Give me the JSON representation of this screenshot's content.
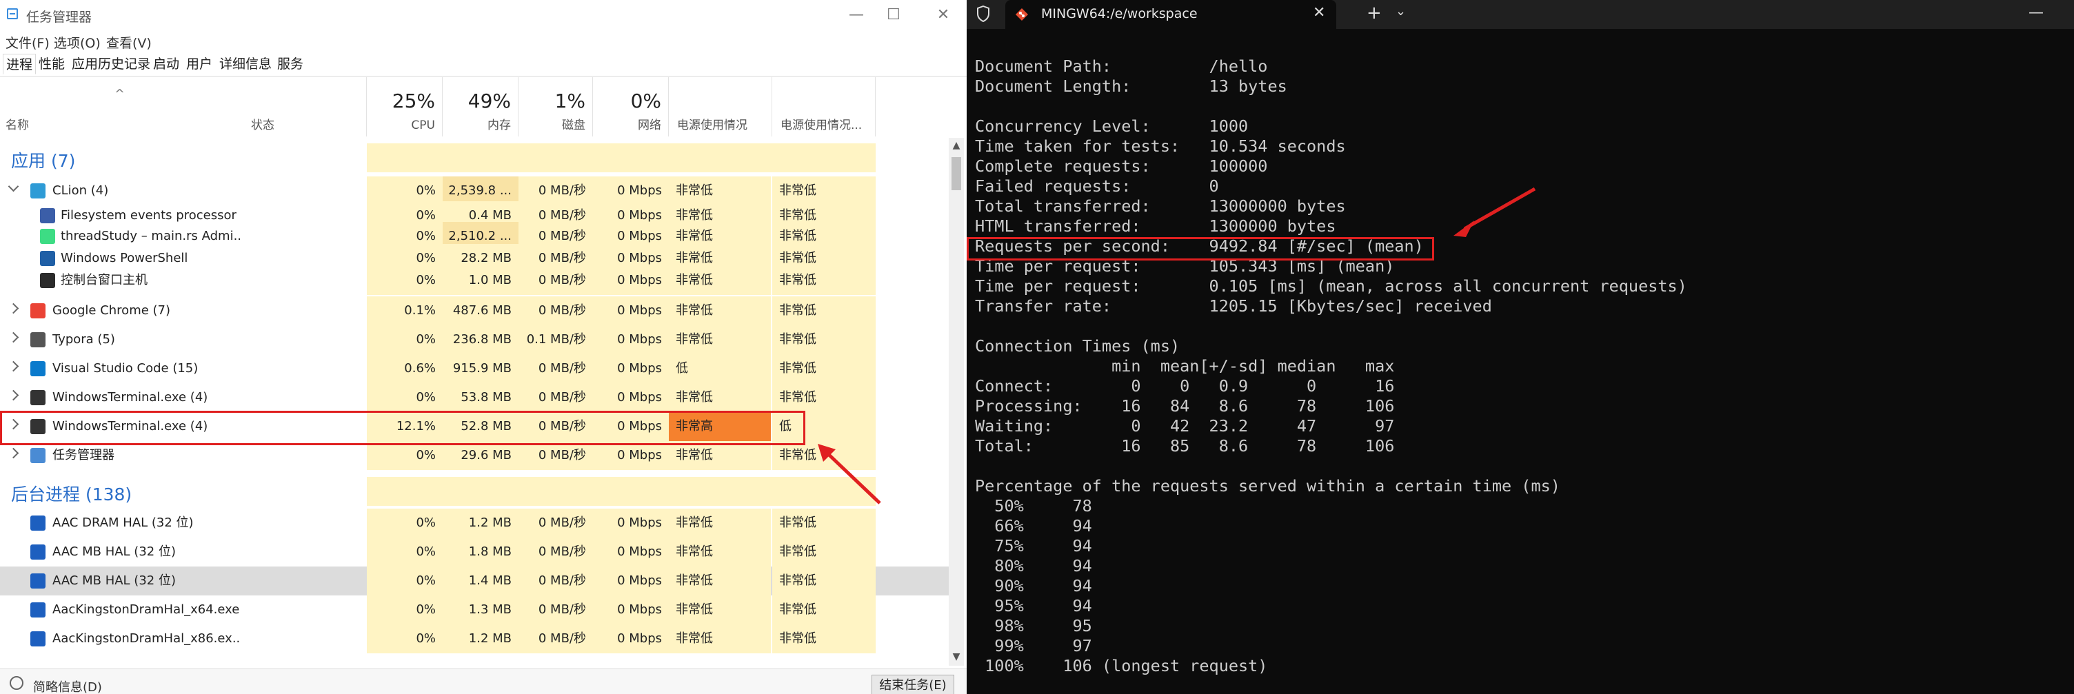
{
  "task_manager": {
    "title": "任务管理器",
    "window_controls": {
      "minimize": "—",
      "maximize": "☐",
      "close": "✕"
    },
    "menu": [
      "文件(F)",
      "选项(O)",
      "查看(V)"
    ],
    "tabs": [
      "进程",
      "性能",
      "应用历史记录",
      "启动",
      "用户",
      "详细信息",
      "服务"
    ],
    "columns": {
      "name": "名称",
      "status": "状态",
      "cpu": {
        "pct": "25%",
        "label": "CPU"
      },
      "memory": {
        "pct": "49%",
        "label": "内存"
      },
      "disk": {
        "pct": "1%",
        "label": "磁盘"
      },
      "network": {
        "pct": "0%",
        "label": "网络"
      },
      "power": "电源使用情况",
      "power_trend": "电源使用情况..."
    },
    "groups": {
      "apps": "应用 (7)",
      "background": "后台进程 (138)"
    },
    "rows": [
      {
        "name": "CLion (4)",
        "cpu": "0%",
        "mem": "2,539.8 ...",
        "disk": "0 MB/秒",
        "net": "0 Mbps",
        "power": "非常低",
        "trend": "非常低"
      },
      {
        "name": "Filesystem events processor",
        "cpu": "0%",
        "mem": "0.4 MB",
        "disk": "0 MB/秒",
        "net": "0 Mbps",
        "power": "非常低",
        "trend": "非常低"
      },
      {
        "name": "threadStudy – main.rs Admi...",
        "cpu": "0%",
        "mem": "2,510.2 ...",
        "disk": "0 MB/秒",
        "net": "0 Mbps",
        "power": "非常低",
        "trend": "非常低"
      },
      {
        "name": "Windows PowerShell",
        "cpu": "0%",
        "mem": "28.2 MB",
        "disk": "0 MB/秒",
        "net": "0 Mbps",
        "power": "非常低",
        "trend": "非常低"
      },
      {
        "name": "控制台窗口主机",
        "cpu": "0%",
        "mem": "1.0 MB",
        "disk": "0 MB/秒",
        "net": "0 Mbps",
        "power": "非常低",
        "trend": "非常低"
      },
      {
        "name": "Google Chrome (7)",
        "cpu": "0.1%",
        "mem": "487.6 MB",
        "disk": "0 MB/秒",
        "net": "0 Mbps",
        "power": "非常低",
        "trend": "非常低"
      },
      {
        "name": "Typora (5)",
        "cpu": "0%",
        "mem": "236.8 MB",
        "disk": "0.1 MB/秒",
        "net": "0 Mbps",
        "power": "非常低",
        "trend": "非常低"
      },
      {
        "name": "Visual Studio Code (15)",
        "cpu": "0.6%",
        "mem": "915.9 MB",
        "disk": "0 MB/秒",
        "net": "0 Mbps",
        "power": "低",
        "trend": "非常低"
      },
      {
        "name": "WindowsTerminal.exe (4)",
        "cpu": "0%",
        "mem": "53.8 MB",
        "disk": "0 MB/秒",
        "net": "0 Mbps",
        "power": "非常低",
        "trend": "非常低"
      },
      {
        "name": "WindowsTerminal.exe (4)",
        "cpu": "12.1%",
        "mem": "52.8 MB",
        "disk": "0 MB/秒",
        "net": "0 Mbps",
        "power": "非常高",
        "trend": "低"
      },
      {
        "name": "任务管理器",
        "cpu": "0%",
        "mem": "29.6 MB",
        "disk": "0 MB/秒",
        "net": "0 Mbps",
        "power": "非常低",
        "trend": "非常低"
      },
      {
        "name": "AAC DRAM HAL (32 位)",
        "cpu": "0%",
        "mem": "1.2 MB",
        "disk": "0 MB/秒",
        "net": "0 Mbps",
        "power": "非常低",
        "trend": "非常低"
      },
      {
        "name": "AAC MB HAL (32 位)",
        "cpu": "0%",
        "mem": "1.8 MB",
        "disk": "0 MB/秒",
        "net": "0 Mbps",
        "power": "非常低",
        "trend": "非常低"
      },
      {
        "name": "AAC MB HAL (32 位)",
        "cpu": "0%",
        "mem": "1.4 MB",
        "disk": "0 MB/秒",
        "net": "0 Mbps",
        "power": "非常低",
        "trend": "非常低"
      },
      {
        "name": "AacKingstonDramHal_x64.exe",
        "cpu": "0%",
        "mem": "1.3 MB",
        "disk": "0 MB/秒",
        "net": "0 Mbps",
        "power": "非常低",
        "trend": "非常低"
      },
      {
        "name": "AacKingstonDramHal_x86.ex...",
        "cpu": "0%",
        "mem": "1.2 MB",
        "disk": "0 MB/秒",
        "net": "0 Mbps",
        "power": "非常低",
        "trend": "非常低"
      }
    ],
    "footer": {
      "less_details": "简略信息(D)",
      "end_task": "结束任务(E)"
    },
    "colors": {
      "highlight": "#f5812e",
      "annotation": "#e02020",
      "group_title": "#2a6ec9"
    }
  },
  "terminal": {
    "tab_title": "MINGW64:/e/workspace",
    "tab_close": "✕",
    "new_tab": "+",
    "dropdown": "⌄",
    "minimize": "—",
    "lines": [
      "Document Path:          /hello",
      "Document Length:        13 bytes",
      "",
      "Concurrency Level:      1000",
      "Time taken for tests:   10.534 seconds",
      "Complete requests:      100000",
      "Failed requests:        0",
      "Total transferred:      13000000 bytes",
      "HTML transferred:       1300000 bytes",
      "Requests per second:    9492.84 [#/sec] (mean)",
      "Time per request:       105.343 [ms] (mean)",
      "Time per request:       0.105 [ms] (mean, across all concurrent requests)",
      "Transfer rate:          1205.15 [Kbytes/sec] received",
      "",
      "Connection Times (ms)",
      "              min  mean[+/-sd] median   max",
      "Connect:        0    0   0.9      0      16",
      "Processing:    16   84   8.6     78     106",
      "Waiting:        0   42  23.2     47      97",
      "Total:         16   85   8.6     78     106",
      "",
      "Percentage of the requests served within a certain time (ms)",
      "  50%     78",
      "  66%     94",
      "  75%     94",
      "  80%     94",
      "  90%     94",
      "  95%     94",
      "  98%     95",
      "  99%     97",
      " 100%    106 (longest request)"
    ]
  }
}
